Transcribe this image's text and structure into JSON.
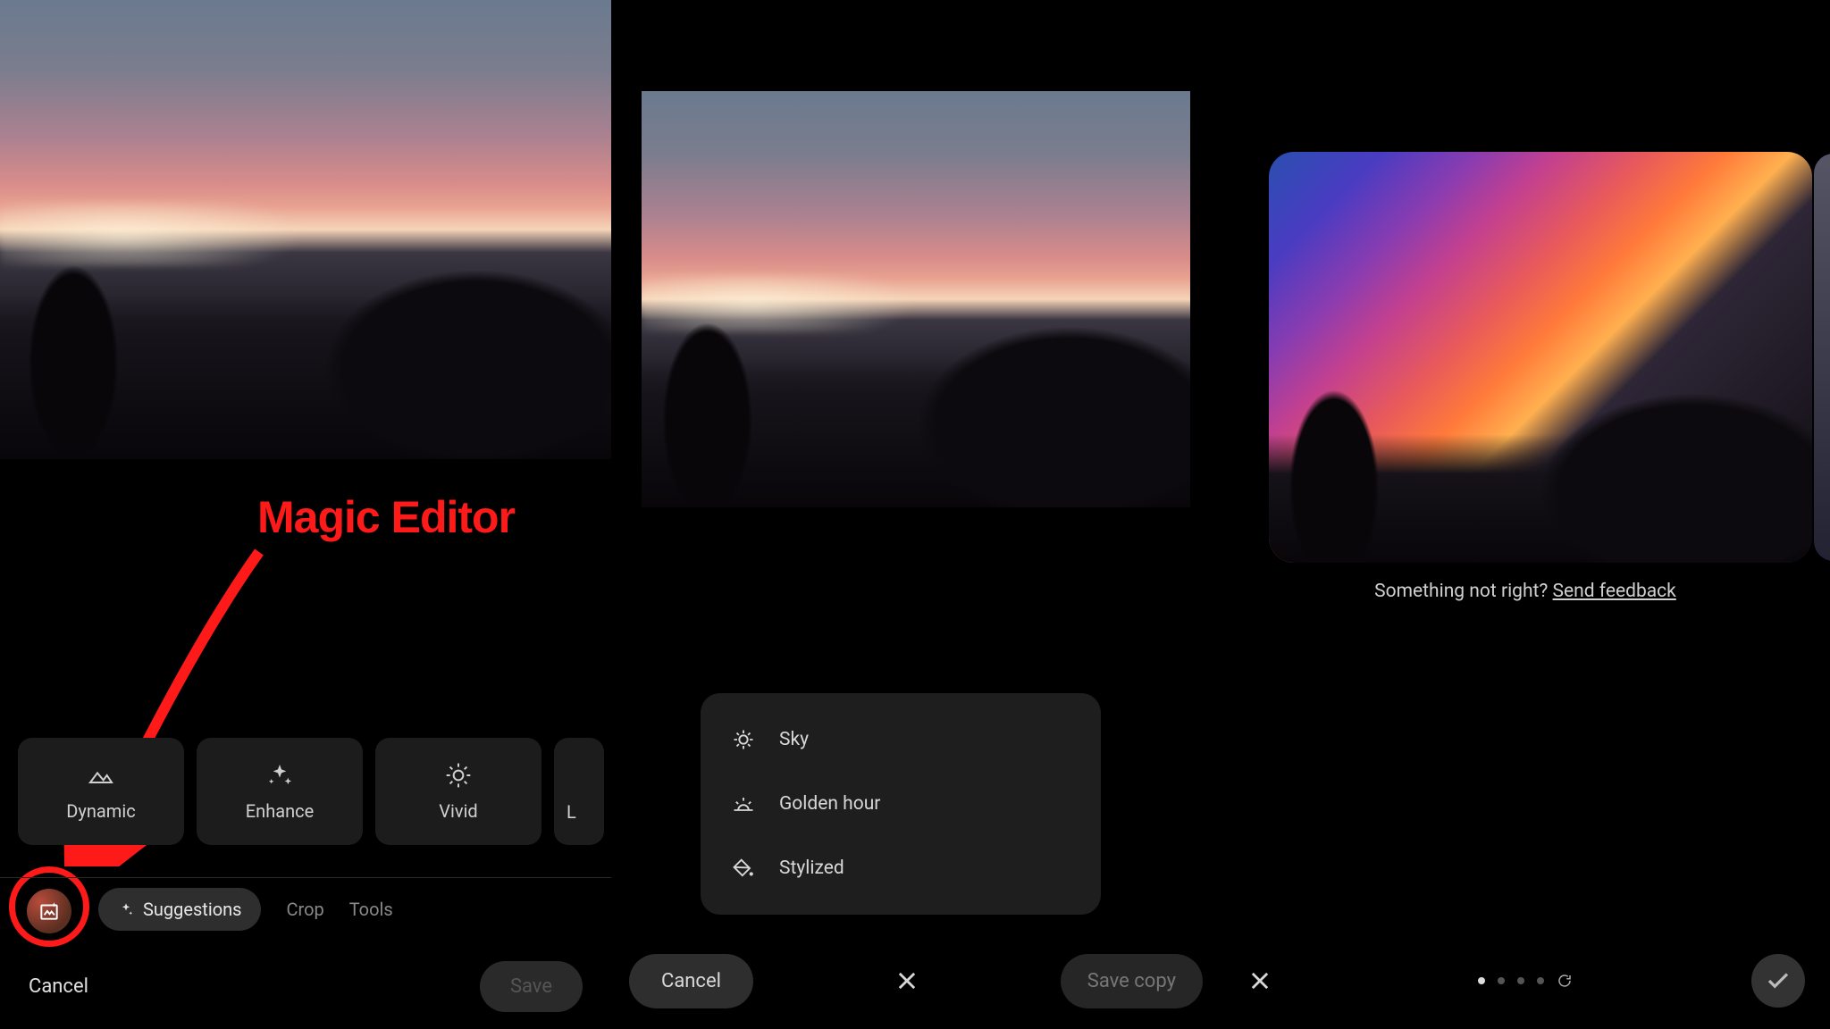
{
  "annotation_label": "Magic Editor",
  "panel1": {
    "suggestions": [
      {
        "id": "dynamic",
        "label": "Dynamic",
        "icon": "landscape"
      },
      {
        "id": "enhance",
        "label": "Enhance",
        "icon": "sparkle"
      },
      {
        "id": "vivid",
        "label": "Vivid",
        "icon": "sun"
      },
      {
        "id": "partial",
        "label": "L",
        "icon": ""
      }
    ],
    "tabs": {
      "suggestions": "Suggestions",
      "crop": "Crop",
      "tools": "Tools"
    },
    "bottom": {
      "cancel": "Cancel",
      "save": "Save"
    }
  },
  "panel2": {
    "menu": [
      {
        "id": "sky",
        "label": "Sky",
        "icon": "sun-rays"
      },
      {
        "id": "golden",
        "label": "Golden hour",
        "icon": "horizon"
      },
      {
        "id": "stylized",
        "label": "Stylized",
        "icon": "paint-bucket"
      }
    ],
    "bottom": {
      "cancel": "Cancel",
      "savecopy": "Save copy"
    }
  },
  "panel3": {
    "feedback_text": "Something not right? ",
    "feedback_link": "Send feedback",
    "pager": {
      "total": 4,
      "active": 0
    }
  }
}
